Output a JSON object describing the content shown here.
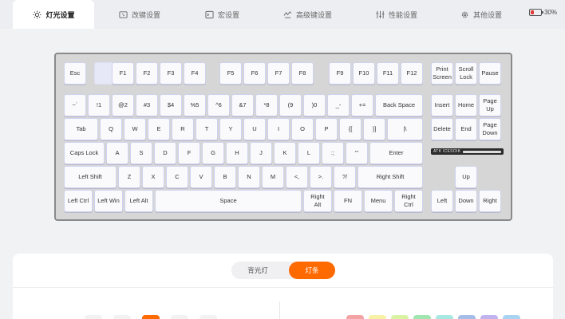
{
  "tabs": [
    {
      "label": "灯光设置",
      "icon": "sun-icon",
      "active": true
    },
    {
      "label": "改键设置",
      "icon": "keyboard-swap-icon",
      "active": false
    },
    {
      "label": "宏设置",
      "icon": "terminal-icon",
      "active": false
    },
    {
      "label": "高级键设置",
      "icon": "lightning-icon",
      "active": false
    },
    {
      "label": "性能设置",
      "icon": "sliders-icon",
      "active": false
    },
    {
      "label": "其他设置",
      "icon": "gear-icon",
      "active": false
    }
  ],
  "battery": {
    "percent_label": "30%",
    "level": 0.3,
    "color": "#e23b3b"
  },
  "keyboard": {
    "brand_text": "ATK ICESOIK",
    "keys": {
      "esc": "Esc",
      "f1": "F1",
      "f2": "F2",
      "f3": "F3",
      "f4": "F4",
      "f5": "F5",
      "f6": "F6",
      "f7": "F7",
      "f8": "F8",
      "f9": "F9",
      "f10": "F10",
      "f11": "F11",
      "f12": "F12",
      "print_screen": "Print\nScreen",
      "scroll_lock": "Scroll\nLock",
      "pause": "Pause",
      "grave": "~`",
      "n1": "!1",
      "n2": "@2",
      "n3": "#3",
      "n4": "$4",
      "n5": "%5",
      "n6": "^6",
      "n7": "&7",
      "n8": "*8",
      "n9": "(9",
      "n0": ")0",
      "minus": "_-",
      "equal": "+=",
      "backspace": "Back Space",
      "insert": "Insert",
      "home": "Home",
      "page_up": "Page\nUp",
      "tab": "Tab",
      "q": "Q",
      "w": "W",
      "e": "E",
      "r": "R",
      "t": "T",
      "y": "Y",
      "u": "U",
      "i": "I",
      "o": "O",
      "p": "P",
      "lbracket": "{[",
      "rbracket": "}]",
      "backslash": "|\\",
      "delete": "Delete",
      "end": "End",
      "page_down": "Page\nDown",
      "caps": "Caps Lock",
      "a": "A",
      "s": "S",
      "d": "D",
      "f": "F",
      "g": "G",
      "h": "H",
      "j": "J",
      "k": "K",
      "l": "L",
      "semicolon": ":;",
      "quote": "\"'",
      "enter": "Enter",
      "lshift": "Left Shift",
      "z": "Z",
      "x": "X",
      "c": "C",
      "v": "V",
      "b": "B",
      "n": "N",
      "m": "M",
      "comma": "<,",
      "period": ">.",
      "slash": "?/",
      "rshift": "Right Shift",
      "up": "Up",
      "lctrl": "Left Ctrl",
      "lwin": "Left Win",
      "lalt": "Left Alt",
      "space": "Space",
      "ralt": "Right\nAlt",
      "fn": "FN",
      "menu": "Menu",
      "rctrl": "Right\nCtrl",
      "left": "Left",
      "down": "Down",
      "right": "Right"
    }
  },
  "light_mode": {
    "options": [
      "背光灯",
      "灯条"
    ],
    "selected": "灯条",
    "accent": "#ff6a00"
  },
  "swatch_colors": {
    "left": [
      "#f2f2f2",
      "#f2f2f2",
      "#ff6a00",
      "#f2f2f2",
      "#f2f2f2"
    ],
    "right": [
      "#f2a3a3",
      "#f7f3a6",
      "#d8f3a1",
      "#9fe6b0",
      "#a8e8e2",
      "#a6bde8",
      "#c0b4ee",
      "#a8d4f2"
    ]
  }
}
